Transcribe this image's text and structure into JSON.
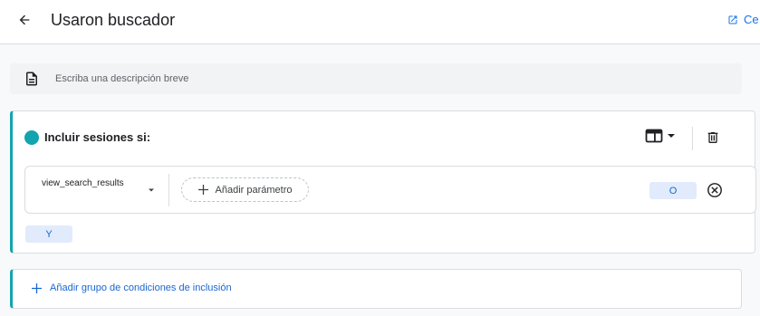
{
  "header": {
    "title": "Usaron buscador",
    "close_label": "Ce"
  },
  "description": {
    "placeholder": "Escriba una descripción breve"
  },
  "condition_group": {
    "title": "Incluir sesiones si:",
    "condition": {
      "event_name": "view_search_results",
      "add_parameter_label": "Añadir parámetro",
      "or_label": "O"
    },
    "and_label": "Y"
  },
  "add_group_label": "Añadir grupo de condiciones de inclusión",
  "colors": {
    "accent": "#12a4af",
    "primary": "#1a73e8",
    "chip_bg": "#e1ebfb"
  },
  "icons": [
    "arrow-back-icon",
    "open-in-new-icon",
    "description-icon",
    "card-view-icon",
    "dropdown-caret-icon",
    "delete-icon",
    "plus-icon",
    "remove-circle-icon"
  ]
}
